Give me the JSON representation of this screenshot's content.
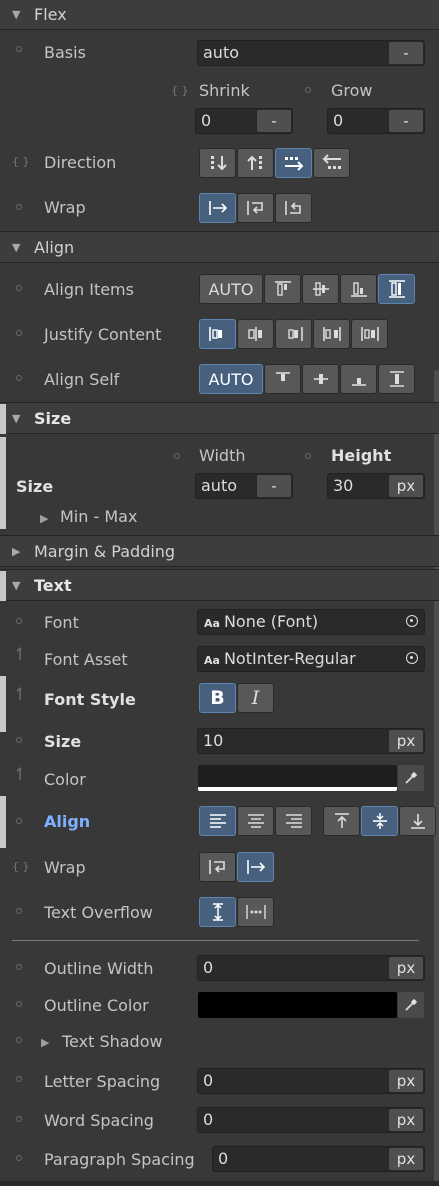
{
  "sections": {
    "flex": "Flex",
    "align": "Align",
    "size": "Size",
    "margin_padding": "Margin & Padding",
    "text": "Text"
  },
  "flex": {
    "basis_label": "Basis",
    "basis_value": "auto",
    "shrink_label": "Shrink",
    "shrink_value": "0",
    "grow_label": "Grow",
    "grow_value": "0",
    "direction_label": "Direction",
    "wrap_label": "Wrap"
  },
  "align": {
    "items_label": "Align Items",
    "items_auto": "AUTO",
    "justify_label": "Justify Content",
    "self_label": "Align Self",
    "self_auto": "AUTO"
  },
  "size": {
    "width_label": "Width",
    "height_label": "Height",
    "row_label": "Size",
    "width_value": "auto",
    "height_value": "30",
    "height_unit": "px",
    "minmax_label": "Min - Max"
  },
  "text": {
    "font_label": "Font",
    "font_value": "None (Font)",
    "font_asset_label": "Font Asset",
    "font_asset_value": "NotInter-Regular",
    "aa": "Aa",
    "font_style_label": "Font Style",
    "bold_glyph": "B",
    "italic_glyph": "I",
    "size_label": "Size",
    "size_value": "10",
    "size_unit": "px",
    "color_label": "Color",
    "align_label": "Align",
    "wrap_label": "Wrap",
    "overflow_label": "Text Overflow",
    "outline_width_label": "Outline Width",
    "outline_width_value": "0",
    "outline_width_unit": "px",
    "outline_color_label": "Outline Color",
    "text_shadow_label": "Text Shadow",
    "letter_spacing_label": "Letter Spacing",
    "letter_spacing_value": "0",
    "letter_spacing_unit": "px",
    "word_spacing_label": "Word Spacing",
    "word_spacing_value": "0",
    "word_spacing_unit": "px",
    "paragraph_spacing_label": "Paragraph Spacing",
    "paragraph_spacing_value": "0",
    "paragraph_spacing_unit": "px"
  },
  "common": {
    "minus": "-",
    "curly": "{ }"
  },
  "colors": {
    "panel_bg": "#383838",
    "header_bg": "#3d3d3d",
    "active_btn": "#46607e",
    "accent_label": "#7eb2ff",
    "text_color_swatch": "#1e1e1e",
    "outline_color_swatch": "#000000"
  }
}
